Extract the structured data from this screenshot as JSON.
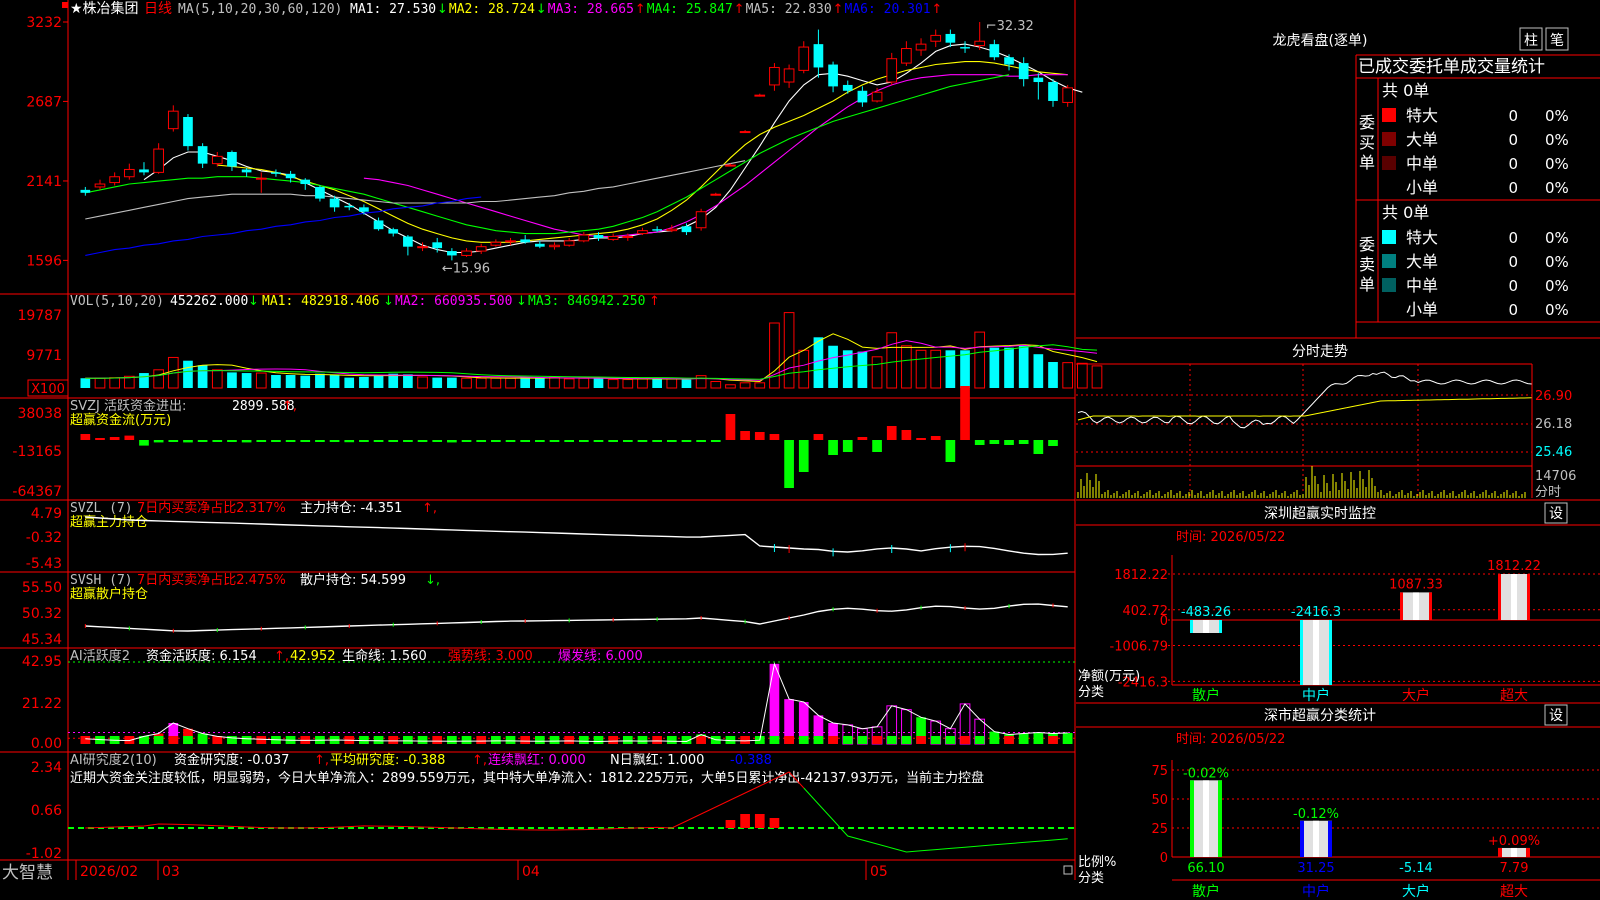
{
  "header": {
    "stock_name": "★株冶集团",
    "period": "日线",
    "ma_params": "MA(5,10,20,30,60,120)",
    "ma_values": [
      {
        "label": "MA1: 27.530",
        "arrow": "↓",
        "color": "#ffffff"
      },
      {
        "label": "MA2: 28.724",
        "arrow": "↓",
        "color": "#ffff00"
      },
      {
        "label": "MA3: 28.665",
        "arrow": "↑",
        "color": "#ff00ff"
      },
      {
        "label": "MA4: 25.847",
        "arrow": "↑",
        "color": "#00ff00"
      },
      {
        "label": "MA5: 22.830",
        "arrow": "↑",
        "color": "#c0c0c0"
      },
      {
        "label": "MA6: 20.301",
        "arrow": "↑",
        "color": "#0000ff"
      }
    ]
  },
  "price_axis": [
    "3232",
    "2687",
    "2141",
    "1596"
  ],
  "price_annotations": {
    "high": "32.32",
    "low": "15.96"
  },
  "candles": [
    {
      "o": 20.8,
      "c": 20.6,
      "h": 21.0,
      "l": 20.4
    },
    {
      "o": 21.0,
      "c": 21.2,
      "h": 21.5,
      "l": 20.8
    },
    {
      "o": 21.3,
      "c": 21.7,
      "h": 22.0,
      "l": 21.1
    },
    {
      "o": 21.7,
      "c": 22.2,
      "h": 22.6,
      "l": 21.5
    },
    {
      "o": 22.2,
      "c": 22.0,
      "h": 22.7,
      "l": 21.8
    },
    {
      "o": 22.0,
      "c": 23.6,
      "h": 24.0,
      "l": 21.9
    },
    {
      "o": 25.0,
      "c": 26.2,
      "h": 26.6,
      "l": 24.8
    },
    {
      "o": 25.8,
      "c": 23.8,
      "h": 26.0,
      "l": 23.5
    },
    {
      "o": 23.8,
      "c": 22.6,
      "h": 24.0,
      "l": 22.3
    },
    {
      "o": 22.6,
      "c": 23.1,
      "h": 23.4,
      "l": 22.4
    },
    {
      "o": 23.4,
      "c": 22.4,
      "h": 23.5,
      "l": 22.1
    },
    {
      "o": 22.2,
      "c": 22.0,
      "h": 22.3,
      "l": 21.7
    },
    {
      "o": 21.6,
      "c": 21.6,
      "h": 22.0,
      "l": 20.6
    },
    {
      "o": 22.0,
      "c": 21.9,
      "h": 22.2,
      "l": 21.7
    },
    {
      "o": 21.9,
      "c": 21.6,
      "h": 22.1,
      "l": 21.3
    },
    {
      "o": 21.5,
      "c": 21.2,
      "h": 21.6,
      "l": 20.8
    },
    {
      "o": 21.0,
      "c": 20.2,
      "h": 21.1,
      "l": 20.0
    },
    {
      "o": 20.2,
      "c": 19.6,
      "h": 20.4,
      "l": 19.3
    },
    {
      "o": 19.7,
      "c": 19.6,
      "h": 19.9,
      "l": 19.4
    },
    {
      "o": 19.6,
      "c": 19.3,
      "h": 19.8,
      "l": 19.1
    },
    {
      "o": 18.7,
      "c": 18.1,
      "h": 18.9,
      "l": 18.0
    },
    {
      "o": 18.1,
      "c": 17.8,
      "h": 18.2,
      "l": 17.6
    },
    {
      "o": 17.6,
      "c": 16.9,
      "h": 17.7,
      "l": 16.3
    },
    {
      "o": 16.9,
      "c": 16.9,
      "h": 17.2,
      "l": 16.6
    },
    {
      "o": 17.2,
      "c": 16.8,
      "h": 17.5,
      "l": 16.5
    },
    {
      "o": 16.6,
      "c": 16.3,
      "h": 16.8,
      "l": 15.96
    },
    {
      "o": 16.3,
      "c": 16.6,
      "h": 16.8,
      "l": 16.2
    },
    {
      "o": 16.6,
      "c": 16.9,
      "h": 17.1,
      "l": 16.4
    },
    {
      "o": 17.0,
      "c": 17.2,
      "h": 17.4,
      "l": 16.9
    },
    {
      "o": 17.3,
      "c": 17.3,
      "h": 17.5,
      "l": 17.0
    },
    {
      "o": 17.4,
      "c": 17.2,
      "h": 17.7,
      "l": 17.1
    },
    {
      "o": 17.1,
      "c": 16.9,
      "h": 17.3,
      "l": 16.8
    },
    {
      "o": 16.9,
      "c": 17.0,
      "h": 17.2,
      "l": 16.7
    },
    {
      "o": 17.0,
      "c": 17.3,
      "h": 17.5,
      "l": 16.9
    },
    {
      "o": 17.3,
      "c": 17.7,
      "h": 17.9,
      "l": 17.2
    },
    {
      "o": 17.7,
      "c": 17.5,
      "h": 17.9,
      "l": 17.3
    },
    {
      "o": 17.4,
      "c": 17.6,
      "h": 17.8,
      "l": 17.3
    },
    {
      "o": 17.6,
      "c": 17.6,
      "h": 17.8,
      "l": 17.3
    },
    {
      "o": 17.8,
      "c": 18.0,
      "h": 18.2,
      "l": 17.7
    },
    {
      "o": 18.1,
      "c": 18.0,
      "h": 18.3,
      "l": 17.9
    },
    {
      "o": 18.0,
      "c": 18.1,
      "h": 18.4,
      "l": 17.9
    },
    {
      "o": 18.3,
      "c": 17.9,
      "h": 18.5,
      "l": 17.7
    },
    {
      "o": 18.2,
      "c": 19.3,
      "h": 19.5,
      "l": 18.0
    },
    {
      "o": 20.5,
      "c": 20.5,
      "h": 20.6,
      "l": 20.4
    },
    {
      "o": 22.5,
      "c": 22.5,
      "h": 22.6,
      "l": 22.4
    },
    {
      "o": 24.8,
      "c": 24.8,
      "h": 24.9,
      "l": 24.7
    },
    {
      "o": 27.3,
      "c": 27.3,
      "h": 27.4,
      "l": 27.2
    },
    {
      "o": 28.0,
      "c": 29.2,
      "h": 29.5,
      "l": 27.6
    },
    {
      "o": 28.2,
      "c": 29.1,
      "h": 29.4,
      "l": 27.8
    },
    {
      "o": 29.0,
      "c": 30.6,
      "h": 31.0,
      "l": 28.8
    },
    {
      "o": 30.8,
      "c": 29.2,
      "h": 31.8,
      "l": 28.5
    },
    {
      "o": 29.4,
      "c": 27.9,
      "h": 29.6,
      "l": 27.5
    },
    {
      "o": 28.0,
      "c": 27.6,
      "h": 28.3,
      "l": 27.4
    },
    {
      "o": 27.6,
      "c": 26.8,
      "h": 27.9,
      "l": 26.5
    },
    {
      "o": 26.9,
      "c": 27.5,
      "h": 27.8,
      "l": 26.8
    },
    {
      "o": 28.2,
      "c": 29.8,
      "h": 30.2,
      "l": 28.0
    },
    {
      "o": 29.5,
      "c": 30.5,
      "h": 31.0,
      "l": 29.3
    },
    {
      "o": 30.4,
      "c": 30.8,
      "h": 31.2,
      "l": 30.0
    },
    {
      "o": 31.0,
      "c": 31.4,
      "h": 31.8,
      "l": 30.6
    },
    {
      "o": 31.5,
      "c": 30.9,
      "h": 31.8,
      "l": 30.6
    },
    {
      "o": 30.6,
      "c": 30.5,
      "h": 31.0,
      "l": 30.2
    },
    {
      "o": 30.7,
      "c": 31.0,
      "h": 32.32,
      "l": 30.4
    },
    {
      "o": 30.8,
      "c": 29.9,
      "h": 31.1,
      "l": 29.7
    },
    {
      "o": 29.9,
      "c": 29.4,
      "h": 30.1,
      "l": 29.0
    },
    {
      "o": 29.5,
      "c": 28.4,
      "h": 29.9,
      "l": 27.9
    },
    {
      "o": 28.5,
      "c": 28.2,
      "h": 28.8,
      "l": 27.0
    },
    {
      "o": 28.2,
      "c": 26.9,
      "h": 28.4,
      "l": 26.5
    },
    {
      "o": 26.8,
      "c": 27.8,
      "h": 28.0,
      "l": 26.5
    }
  ],
  "ma_lines": {
    "ma1": {
      "color": "#ffffff",
      "from": 4,
      "values": [
        21.5,
        22.2,
        23.0,
        23.4,
        23.4,
        23.1,
        22.8,
        22.4,
        22.1,
        22.0,
        21.8,
        21.3,
        20.8,
        20.3,
        19.8,
        19.2,
        18.6,
        18.0,
        17.5,
        17.0,
        16.7,
        16.5,
        16.5,
        16.6,
        16.8,
        17.0,
        17.2,
        17.3,
        17.3,
        17.3,
        17.4,
        17.5,
        17.5,
        17.6,
        17.8,
        17.9,
        18.0,
        18.3,
        18.8,
        19.6,
        20.8,
        22.3,
        23.8,
        25.4,
        26.9,
        28.0,
        28.7,
        28.8,
        28.6,
        28.3,
        28.0,
        28.2,
        28.8,
        29.5,
        30.3,
        30.7,
        30.8,
        30.6,
        30.3,
        29.9,
        29.4,
        28.9,
        28.3,
        27.8,
        27.5
      ]
    },
    "ma2": {
      "color": "#ffff00",
      "from": 9,
      "values": [
        22.5,
        22.4,
        22.3,
        22.2,
        22.0,
        21.7,
        21.4,
        21.1,
        20.8,
        20.4,
        20.0,
        19.5,
        19.0,
        18.5,
        18.1,
        17.8,
        17.5,
        17.3,
        17.2,
        17.2,
        17.2,
        17.3,
        17.4,
        17.5,
        17.6,
        17.7,
        17.8,
        17.9,
        18.1,
        18.4,
        18.8,
        19.4,
        20.1,
        21.0,
        22.0,
        23.0,
        23.9,
        24.6,
        25.1,
        25.5,
        25.9,
        26.4,
        26.9,
        27.5,
        28.0,
        28.4,
        28.7,
        29.0,
        29.2,
        29.4,
        29.5,
        29.6,
        29.6,
        29.5,
        29.3,
        29.1,
        28.9,
        28.8,
        28.7
      ]
    },
    "ma3": {
      "color": "#ff00ff",
      "from": 19,
      "values": [
        21.6,
        21.5,
        21.3,
        21.1,
        20.8,
        20.5,
        20.2,
        19.9,
        19.6,
        19.3,
        19.0,
        18.7,
        18.4,
        18.1,
        17.9,
        17.7,
        17.6,
        17.6,
        17.7,
        17.8,
        17.9,
        18.2,
        18.6,
        19.1,
        19.7,
        20.4,
        21.1,
        21.9,
        22.7,
        23.5,
        24.3,
        25.1,
        25.8,
        26.5,
        27.1,
        27.6,
        28.0,
        28.3,
        28.5,
        28.6,
        28.7,
        28.7,
        28.7,
        28.7,
        28.6,
        28.6,
        28.7,
        28.7,
        28.7
      ]
    },
    "ma4": {
      "color": "#00ff00",
      "from": 0,
      "values": [
        20.6,
        20.8,
        21.0,
        21.2,
        21.3,
        21.4,
        21.5,
        21.6,
        21.6,
        21.7,
        21.7,
        21.7,
        21.6,
        21.5,
        21.4,
        21.3,
        21.1,
        20.9,
        20.7,
        20.5,
        20.2,
        19.9,
        19.6,
        19.3,
        19.0,
        18.7,
        18.4,
        18.2,
        18.0,
        17.9,
        17.8,
        17.8,
        17.8,
        17.9,
        18.0,
        18.1,
        18.3,
        18.6,
        18.9,
        19.3,
        19.8,
        20.3,
        20.9,
        21.5,
        22.1,
        22.7,
        23.3,
        23.8,
        24.3,
        24.7,
        25.1,
        25.5,
        25.8,
        26.1,
        26.4,
        26.7,
        27.0,
        27.3,
        27.6,
        27.9,
        28.1,
        28.3,
        28.5,
        28.7
      ]
    },
    "ma5": {
      "color": "#c0c0c0",
      "from": 0,
      "values": [
        18.8,
        19.0,
        19.2,
        19.4,
        19.6,
        19.8,
        20.0,
        20.2,
        20.3,
        20.4,
        20.5,
        20.5,
        20.5,
        20.5,
        20.5,
        20.4,
        20.4,
        20.3,
        20.2,
        20.1,
        20.0,
        19.9,
        19.9,
        19.9,
        19.9,
        19.9,
        19.9,
        20.0,
        20.0,
        20.1,
        20.2,
        20.3,
        20.4,
        20.6,
        20.7,
        20.9,
        21.0,
        21.2,
        21.4,
        21.6,
        21.8,
        22.0,
        22.2,
        22.4,
        22.6,
        22.8
      ]
    },
    "ma6": {
      "color": "#0000ff",
      "from": 0,
      "values": [
        16.3,
        16.5,
        16.7,
        16.8,
        17.0,
        17.1,
        17.3,
        17.4,
        17.6,
        17.7,
        17.8,
        18.0,
        18.1,
        18.3,
        18.4,
        18.6,
        18.7,
        18.9,
        19.0,
        19.2,
        19.3,
        19.5,
        19.6,
        19.7,
        19.9,
        20.0,
        20.2,
        20.3
      ]
    }
  },
  "vol": {
    "title": "VOL(5,10,20)",
    "value": "452262.000",
    "value_arrow": "↓",
    "ma1": "MA1: 482918.406",
    "ma1_arrow": "↓",
    "ma2": "MA2: 660935.500",
    "ma2_arrow": "↓",
    "ma3": "MA3: 846942.250",
    "ma3_arrow": "↑",
    "axis": [
      "19787",
      "9771",
      "X100"
    ],
    "bars": [
      1.5,
      1.5,
      1.6,
      1.8,
      2.3,
      2.8,
      4.7,
      4.2,
      3.5,
      2.8,
      2.4,
      2.3,
      2.3,
      2.0,
      2.0,
      1.9,
      2.2,
      2.0,
      1.6,
      1.7,
      2.0,
      2.2,
      2.1,
      1.7,
      1.6,
      1.6,
      1.5,
      1.5,
      1.5,
      1.5,
      1.6,
      1.5,
      1.7,
      1.4,
      1.5,
      1.5,
      1.3,
      1.3,
      1.4,
      1.5,
      1.4,
      1.3,
      1.9,
      1.0,
      0.5,
      0.8,
      0.8,
      10.0,
      11.6,
      5.8,
      7.8,
      6.5,
      5.8,
      5.6,
      4.8,
      8.5,
      6.5,
      5.8,
      5.8,
      5.8,
      5.8,
      8.6,
      6.2,
      6.2,
      6.5,
      5.2,
      4.0,
      3.9,
      3.8,
      3.4
    ]
  },
  "svzj": {
    "title": "SVZJ  活跃资金进出:",
    "value": "2899.588",
    "arrow": "↑",
    "label2": "超赢资金流(万元)",
    "axis": [
      "38038",
      "-13165",
      "-64367"
    ],
    "bars": [
      3.0,
      0.8,
      1.5,
      2.2,
      -2.8,
      -1.2,
      -1.0,
      -1.2,
      -1.0,
      -0.8,
      -1.0,
      -1.2,
      -0.9,
      -0.8,
      -1.0,
      -0.9,
      -1.0,
      -0.9,
      -1.1,
      -1.0,
      -0.9,
      -1.0,
      -0.8,
      -0.9,
      -1.0,
      -1.2,
      -0.8,
      -0.9,
      -0.8,
      -0.9,
      -1.0,
      -0.9,
      -0.8,
      -0.9,
      -0.8,
      -0.9,
      -0.8,
      -1.0,
      -0.9,
      -0.9,
      -1.0,
      -0.8,
      -0.9,
      -0.8,
      13.0,
      4.5,
      4.0,
      3.0,
      -24.0,
      -16.0,
      3.0,
      -7.5,
      -6.0,
      1.5,
      -6.0,
      7.0,
      5.0,
      1.0,
      2.0,
      -11.0,
      27.0,
      -2.5,
      -2.0,
      -2.5,
      -2.0,
      -7.0,
      -3.0
    ]
  },
  "svzl": {
    "title": "SVZL (7)",
    "desc": "7日内买卖净占比2.317%",
    "label": "主力持仓: -4.351",
    "arrow": "↑",
    "label2": "超赢主力持仓",
    "axis": [
      "4.79",
      "-0.32",
      "-5.43"
    ]
  },
  "svsh": {
    "title": "SVSH (7)",
    "desc": "7日内买卖净占比2.475%",
    "label": "散户持仓: 54.599",
    "arrow": "↓",
    "label2": "超赢散户持仓",
    "axis": [
      "55.50",
      "50.32",
      "45.34"
    ]
  },
  "ai1": {
    "title": "AI活跃度2",
    "label": "资金活跃度: 6.154",
    "val2": "42.952",
    "life": "生命线: 1.560",
    "strong": "强势线: 3.000",
    "burst": "爆发线: 6.000",
    "axis": [
      "42.95",
      "21.22",
      "0.00"
    ],
    "bars": [
      2.8,
      2.3,
      2.0,
      1.8,
      4.0,
      5.5,
      11.0,
      8.0,
      5.5,
      4.0,
      3.2,
      2.8,
      2.5,
      2.2,
      2.0,
      1.9,
      2.0,
      2.1,
      2.0,
      1.8,
      1.7,
      1.6,
      1.6,
      1.5,
      1.5,
      1.4,
      1.5,
      1.5,
      1.6,
      1.6,
      1.5,
      1.4,
      1.5,
      1.6,
      1.4,
      1.3,
      1.5,
      1.6,
      1.5,
      1.6,
      1.4,
      1.3,
      5.0,
      2.2,
      1.8,
      1.6,
      2.0,
      42.0,
      23.5,
      22.0,
      15.0,
      11.0,
      10.0,
      8.0,
      9.0,
      20.0,
      18.0,
      14.0,
      12.0,
      8.0,
      21.0,
      13.0,
      6.5,
      5.0,
      5.5,
      6.0,
      5.5,
      5.8
    ]
  },
  "ai2": {
    "title": "AI研究度2(10)",
    "label": "资金研究度: -0.037",
    "avg": "平均研究度: -0.388",
    "red1": "连续飘红: 0.000",
    "red2": "N日飘红: 1.000",
    "last": "-0.388",
    "axis": [
      "2.34",
      "0.66",
      "-1.02"
    ],
    "commentary": "近期大资金关注度较低，明显弱势，今日大单净流入：2899.559万元，其中特大单净流入：1812.225万元，大单5日累计净出-42137.93万元，当前主力控盘"
  },
  "date_axis": {
    "labels": [
      "2026/02",
      "03",
      "04",
      "05"
    ]
  },
  "brand": "大智慧",
  "dragon": {
    "title": "龙虎看盘(逐单)",
    "btn_bar": "柱",
    "btn_pen": "笔",
    "sub_title": "已成交委托单成交量统计",
    "buy_label": "委买单",
    "sell_label": "委卖单",
    "buy_total": "共 0单",
    "sell_total": "共 0单",
    "buy_rows": [
      {
        "label": "特大",
        "val": "0",
        "pct": "0%",
        "color": "#ff0000"
      },
      {
        "label": "大单",
        "val": "0",
        "pct": "0%",
        "color": "#800000"
      },
      {
        "label": "中单",
        "val": "0",
        "pct": "0%",
        "color": "#5a0000"
      },
      {
        "label": "小单",
        "val": "0",
        "pct": "0%",
        "color": ""
      }
    ],
    "sell_rows": [
      {
        "label": "特大",
        "val": "0",
        "pct": "0%",
        "color": "#00ffff"
      },
      {
        "label": "大单",
        "val": "0",
        "pct": "0%",
        "color": "#008080"
      },
      {
        "label": "中单",
        "val": "0",
        "pct": "0%",
        "color": "#006060"
      },
      {
        "label": "小单",
        "val": "0",
        "pct": "0%",
        "color": ""
      }
    ]
  },
  "intraday": {
    "title": "分时走势",
    "axis": [
      "26.90",
      "26.18",
      "25.46"
    ],
    "vol_axis": [
      "14706",
      "分时"
    ]
  },
  "realtime": {
    "title": "深圳超赢实时监控",
    "btn": "设",
    "time": "时间: 2026/05/22",
    "axis": [
      "1812.22",
      "402.72",
      "0",
      "-1006.79",
      "-2416.3"
    ],
    "ylabel": "净额(万元)",
    "xlabel": "分类",
    "categories": [
      "散户",
      "中户",
      "大户",
      "超大"
    ],
    "values": [
      -483.26,
      -2416.3,
      1087.33,
      1812.22
    ],
    "labels": [
      "-483.26",
      "-2416.3",
      "1087.33",
      "1812.22"
    ]
  },
  "classify": {
    "title": "深市超赢分类统计",
    "btn": "设",
    "time": "时间: 2026/05/22",
    "axis": [
      "75",
      "50",
      "25",
      "0"
    ],
    "ylabel": "比例%",
    "xlabel": "分类",
    "categories": [
      "散户",
      "中户",
      "大户",
      "超大"
    ],
    "values": [
      66.1,
      31.25,
      -5.14,
      7.79
    ],
    "bottom_labels": [
      "66.10",
      "31.25",
      "-5.14",
      "7.79"
    ],
    "top_labels": [
      "-0.02%",
      "-0.12%",
      "",
      "+0.09%"
    ]
  },
  "chart_data": [
    {
      "type": "candlestick",
      "title": "",
      "ylim": [
        15.96,
        32.32
      ],
      "annotations": [
        "32.32",
        "15.96"
      ]
    },
    {
      "type": "bar",
      "title": "",
      "categories": [
        "散户",
        "中户",
        "大户",
        "超大"
      ],
      "values": [
        -483.26,
        -2416.3,
        1087.33,
        1812.22
      ],
      "ylabel": "净额(万元)",
      "xlabel": "分类",
      "ylim": [
        -2416.3,
        1812.22
      ]
    },
    {
      "type": "bar",
      "title": "",
      "categories": [
        "散户",
        "中户",
        "大户",
        "超大"
      ],
      "values": [
        66.1,
        31.25,
        -5.14,
        7.79
      ],
      "ylabel": "比例%",
      "xlabel": "分类",
      "ylim": [
        0,
        75
      ]
    }
  ]
}
